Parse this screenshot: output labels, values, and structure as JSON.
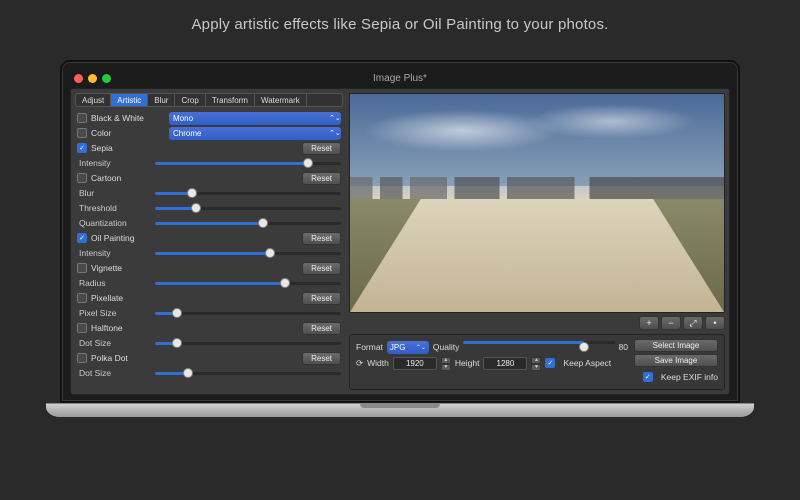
{
  "tagline": "Apply artistic effects like Sepia or Oil Painting to your photos.",
  "window": {
    "title": "Image Plus*"
  },
  "tabs": [
    "Adjust",
    "Artistic",
    "Blur",
    "Crop",
    "Transform",
    "Watermark"
  ],
  "activeTab": "Artistic",
  "effects": {
    "bw": {
      "label": "Black & White",
      "on": false,
      "preset": "Mono"
    },
    "color": {
      "label": "Color",
      "on": false,
      "preset": "Chrome"
    },
    "sepia": {
      "label": "Sepia",
      "on": true,
      "reset": "Reset",
      "params": [
        {
          "name": "Intensity",
          "value": 82
        }
      ]
    },
    "cartoon": {
      "label": "Cartoon",
      "on": false,
      "reset": "Reset",
      "params": [
        {
          "name": "Blur",
          "value": 20
        },
        {
          "name": "Threshold",
          "value": 22
        },
        {
          "name": "Quantization",
          "value": 58
        }
      ]
    },
    "oil": {
      "label": "Oil Painting",
      "on": true,
      "reset": "Reset",
      "params": [
        {
          "name": "Intensity",
          "value": 62
        }
      ]
    },
    "vignette": {
      "label": "Vignette",
      "on": false,
      "reset": "Reset",
      "params": [
        {
          "name": "Radius",
          "value": 70
        }
      ]
    },
    "pixellate": {
      "label": "Pixellate",
      "on": false,
      "reset": "Reset",
      "params": [
        {
          "name": "Pixel Size",
          "value": 12
        }
      ]
    },
    "halftone": {
      "label": "Halftone",
      "on": false,
      "reset": "Reset",
      "params": [
        {
          "name": "Dot Size",
          "value": 12
        }
      ]
    },
    "polka": {
      "label": "Polka Dot",
      "on": false,
      "reset": "Reset",
      "params": [
        {
          "name": "Dot Size",
          "value": 18
        }
      ]
    }
  },
  "previewTools": {
    "zoomIn": "+",
    "zoomOut": "−",
    "fit": "⤢",
    "actual": "•"
  },
  "export": {
    "formatLabel": "Format",
    "format": "JPG",
    "qualityLabel": "Quality",
    "quality": 80,
    "widthLabel": "Width",
    "width": "1920",
    "heightLabel": "Height",
    "height": "1280",
    "keepAspect": {
      "label": "Keep Aspect",
      "on": true
    },
    "keepExif": {
      "label": "Keep EXIF info",
      "on": true
    },
    "selectBtn": "Select Image",
    "saveBtn": "Save Image",
    "rotateIcon": "⟳"
  }
}
